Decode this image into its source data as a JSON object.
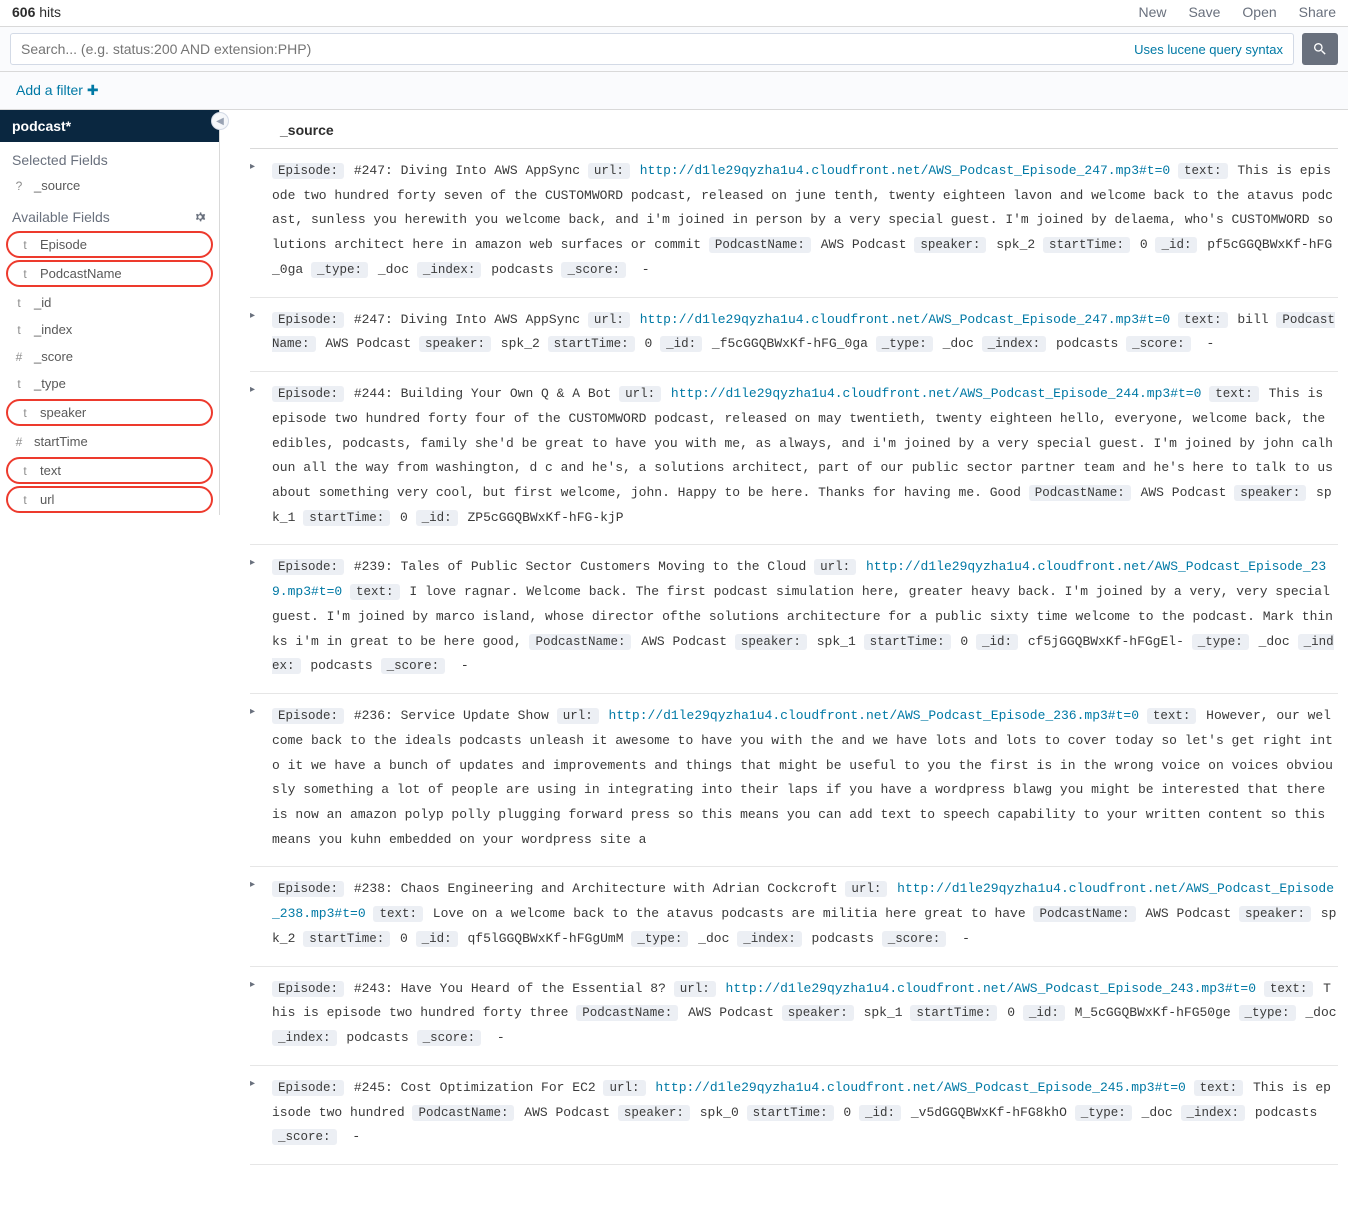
{
  "header": {
    "hits_count": "606",
    "hits_label": "hits",
    "actions": {
      "new": "New",
      "save": "Save",
      "open": "Open",
      "share": "Share"
    }
  },
  "search": {
    "placeholder": "Search... (e.g. status:200 AND extension:PHP)",
    "lucene_hint": "Uses lucene query syntax"
  },
  "filter": {
    "add_label": "Add a filter"
  },
  "sidebar": {
    "index_pattern": "podcast*",
    "selected_label": "Selected Fields",
    "available_label": "Available Fields",
    "selected": [
      {
        "type": "?",
        "name": "_source"
      }
    ],
    "available": [
      {
        "type": "t",
        "name": "Episode",
        "hl": true
      },
      {
        "type": "t",
        "name": "PodcastName",
        "hl": true
      },
      {
        "type": "t",
        "name": "_id"
      },
      {
        "type": "t",
        "name": "_index"
      },
      {
        "type": "#",
        "name": "_score"
      },
      {
        "type": "t",
        "name": "_type"
      },
      {
        "type": "t",
        "name": "speaker",
        "hl": true
      },
      {
        "type": "#",
        "name": "startTime"
      },
      {
        "type": "t",
        "name": "text",
        "hl": true
      },
      {
        "type": "t",
        "name": "url",
        "hl": true
      }
    ]
  },
  "results": {
    "column_label": "_source",
    "docs": [
      {
        "fields": [
          {
            "k": "Episode:",
            "v": "#247: Diving Into AWS AppSync"
          },
          {
            "k": "url:",
            "v": "http://d1le29qyzha1u4.cloudfront.net/AWS_Podcast_Episode_247.mp3#t=0",
            "link": true
          },
          {
            "k": "text:",
            "v": "This is episode two hundred forty seven of the CUSTOMWORD podcast, released on june tenth, twenty eighteen lavon and welcome back to the atavus podcast, sunless you herewith you welcome back, and i'm joined in person by a very special guest. I'm joined by delaema, who's CUSTOMWORD solutions architect here in amazon web surfaces or commit"
          },
          {
            "k": "PodcastName:",
            "v": "AWS Podcast"
          },
          {
            "k": "speaker:",
            "v": "spk_2"
          },
          {
            "k": "startTime:",
            "v": "0"
          },
          {
            "k": "_id:",
            "v": "pf5cGGQBWxKf-hFG_0ga"
          },
          {
            "k": "_type:",
            "v": "_doc"
          },
          {
            "k": "_index:",
            "v": "podcasts"
          },
          {
            "k": "_score:",
            "v": "-",
            "dash": true
          }
        ]
      },
      {
        "fields": [
          {
            "k": "Episode:",
            "v": "#247: Diving Into AWS AppSync"
          },
          {
            "k": "url:",
            "v": "http://d1le29qyzha1u4.cloudfront.net/AWS_Podcast_Episode_247.mp3#t=0",
            "link": true
          },
          {
            "k": "text:",
            "v": "bill"
          },
          {
            "k": "PodcastName:",
            "v": "AWS Podcast"
          },
          {
            "k": "speaker:",
            "v": "spk_2"
          },
          {
            "k": "startTime:",
            "v": "0"
          },
          {
            "k": "_id:",
            "v": "_f5cGGQBWxKf-hFG_0ga"
          },
          {
            "k": "_type:",
            "v": "_doc"
          },
          {
            "k": "_index:",
            "v": "podcasts"
          },
          {
            "k": "_score:",
            "v": "-",
            "dash": true
          }
        ]
      },
      {
        "fields": [
          {
            "k": "Episode:",
            "v": "#244: Building Your Own Q & A Bot"
          },
          {
            "k": "url:",
            "v": "http://d1le29qyzha1u4.cloudfront.net/AWS_Podcast_Episode_244.mp3#t=0",
            "link": true
          },
          {
            "k": "text:",
            "v": "This is episode two hundred forty four of the CUSTOMWORD podcast, released on may twentieth, twenty eighteen hello, everyone, welcome back, the edibles, podcasts, family she'd be great to have you with me, as always, and i'm joined by a very special guest. I'm joined by john calhoun all the way from washington, d c and he's, a solutions architect, part of our public sector partner team and he's here to talk to us about something very cool, but first welcome, john. Happy to be here. Thanks for having me. Good"
          },
          {
            "k": "PodcastName:",
            "v": "AWS Podcast"
          },
          {
            "k": "speaker:",
            "v": "spk_1"
          },
          {
            "k": "startTime:",
            "v": "0"
          },
          {
            "k": "_id:",
            "v": "ZP5cGGQBWxKf-hFG-kjP"
          }
        ]
      },
      {
        "fields": [
          {
            "k": "Episode:",
            "v": "#239: Tales of Public Sector Customers Moving to the Cloud"
          },
          {
            "k": "url:",
            "v": "http://d1le29qyzha1u4.cloudfront.net/AWS_Podcast_Episode_239.mp3#t=0",
            "link": true
          },
          {
            "k": "text:",
            "v": "I love ragnar. Welcome back. The first podcast simulation here, greater heavy back. I'm joined by a very, very special guest. I'm joined by marco island, whose director ofthe solutions architecture for a public sixty time welcome to the podcast. Mark thinks i'm in great to be here good,"
          },
          {
            "k": "PodcastName:",
            "v": "AWS Podcast"
          },
          {
            "k": "speaker:",
            "v": "spk_1"
          },
          {
            "k": "startTime:",
            "v": "0"
          },
          {
            "k": "_id:",
            "v": "cf5jGGQBWxKf-hFGgEl-"
          },
          {
            "k": "_type:",
            "v": "_doc"
          },
          {
            "k": "_index:",
            "v": "podcasts"
          },
          {
            "k": "_score:",
            "v": "-",
            "dash": true
          }
        ]
      },
      {
        "fields": [
          {
            "k": "Episode:",
            "v": "#236: Service Update Show"
          },
          {
            "k": "url:",
            "v": "http://d1le29qyzha1u4.cloudfront.net/AWS_Podcast_Episode_236.mp3#t=0",
            "link": true
          },
          {
            "k": "text:",
            "v": "However, our welcome back to the ideals podcasts unleash it awesome to have you with the and we have lots and lots to cover today so let's get right into it we have a bunch of updates and improvements and things that might be useful to you the first is in the wrong voice on voices obviously something a lot of people are using in integrating into their laps if you have a wordpress blawg you might be interested that there is now an amazon polyp polly plugging forward press so this means you can add text to speech capability to your written content so this means you kuhn embedded on your wordpress site a"
          }
        ]
      },
      {
        "fields": [
          {
            "k": "Episode:",
            "v": "#238: Chaos Engineering and Architecture with Adrian Cockcroft"
          },
          {
            "k": "url:",
            "v": "http://d1le29qyzha1u4.cloudfront.net/AWS_Podcast_Episode_238.mp3#t=0",
            "link": true
          },
          {
            "k": "text:",
            "v": "Love on a welcome back to the atavus podcasts are militia here great to have"
          },
          {
            "k": "PodcastName:",
            "v": "AWS Podcast"
          },
          {
            "k": "speaker:",
            "v": "spk_2"
          },
          {
            "k": "startTime:",
            "v": "0"
          },
          {
            "k": "_id:",
            "v": "qf5lGGQBWxKf-hFGgUmM"
          },
          {
            "k": "_type:",
            "v": "_doc"
          },
          {
            "k": "_index:",
            "v": "podcasts"
          },
          {
            "k": "_score:",
            "v": "-",
            "dash": true
          }
        ]
      },
      {
        "fields": [
          {
            "k": "Episode:",
            "v": "#243: Have You Heard of the Essential 8?"
          },
          {
            "k": "url:",
            "v": "http://d1le29qyzha1u4.cloudfront.net/AWS_Podcast_Episode_243.mp3#t=0",
            "link": true
          },
          {
            "k": "text:",
            "v": "This is episode two hundred forty three"
          },
          {
            "k": "PodcastName:",
            "v": "AWS Podcast"
          },
          {
            "k": "speaker:",
            "v": "spk_1"
          },
          {
            "k": "startTime:",
            "v": "0"
          },
          {
            "k": "_id:",
            "v": "M_5cGGQBWxKf-hFG50ge"
          },
          {
            "k": "_type:",
            "v": "_doc"
          },
          {
            "k": "_index:",
            "v": "podcasts"
          },
          {
            "k": "_score:",
            "v": "-",
            "dash": true
          }
        ]
      },
      {
        "fields": [
          {
            "k": "Episode:",
            "v": "#245: Cost Optimization For EC2"
          },
          {
            "k": "url:",
            "v": "http://d1le29qyzha1u4.cloudfront.net/AWS_Podcast_Episode_245.mp3#t=0",
            "link": true
          },
          {
            "k": "text:",
            "v": "This is episode two hundred"
          },
          {
            "k": "PodcastName:",
            "v": "AWS Podcast"
          },
          {
            "k": "speaker:",
            "v": "spk_0"
          },
          {
            "k": "startTime:",
            "v": "0"
          },
          {
            "k": "_id:",
            "v": "_v5dGGQBWxKf-hFG8khO"
          },
          {
            "k": "_type:",
            "v": "_doc"
          },
          {
            "k": "_index:",
            "v": "podcasts"
          },
          {
            "k": "_score:",
            "v": "-",
            "dash": true
          }
        ]
      }
    ]
  }
}
